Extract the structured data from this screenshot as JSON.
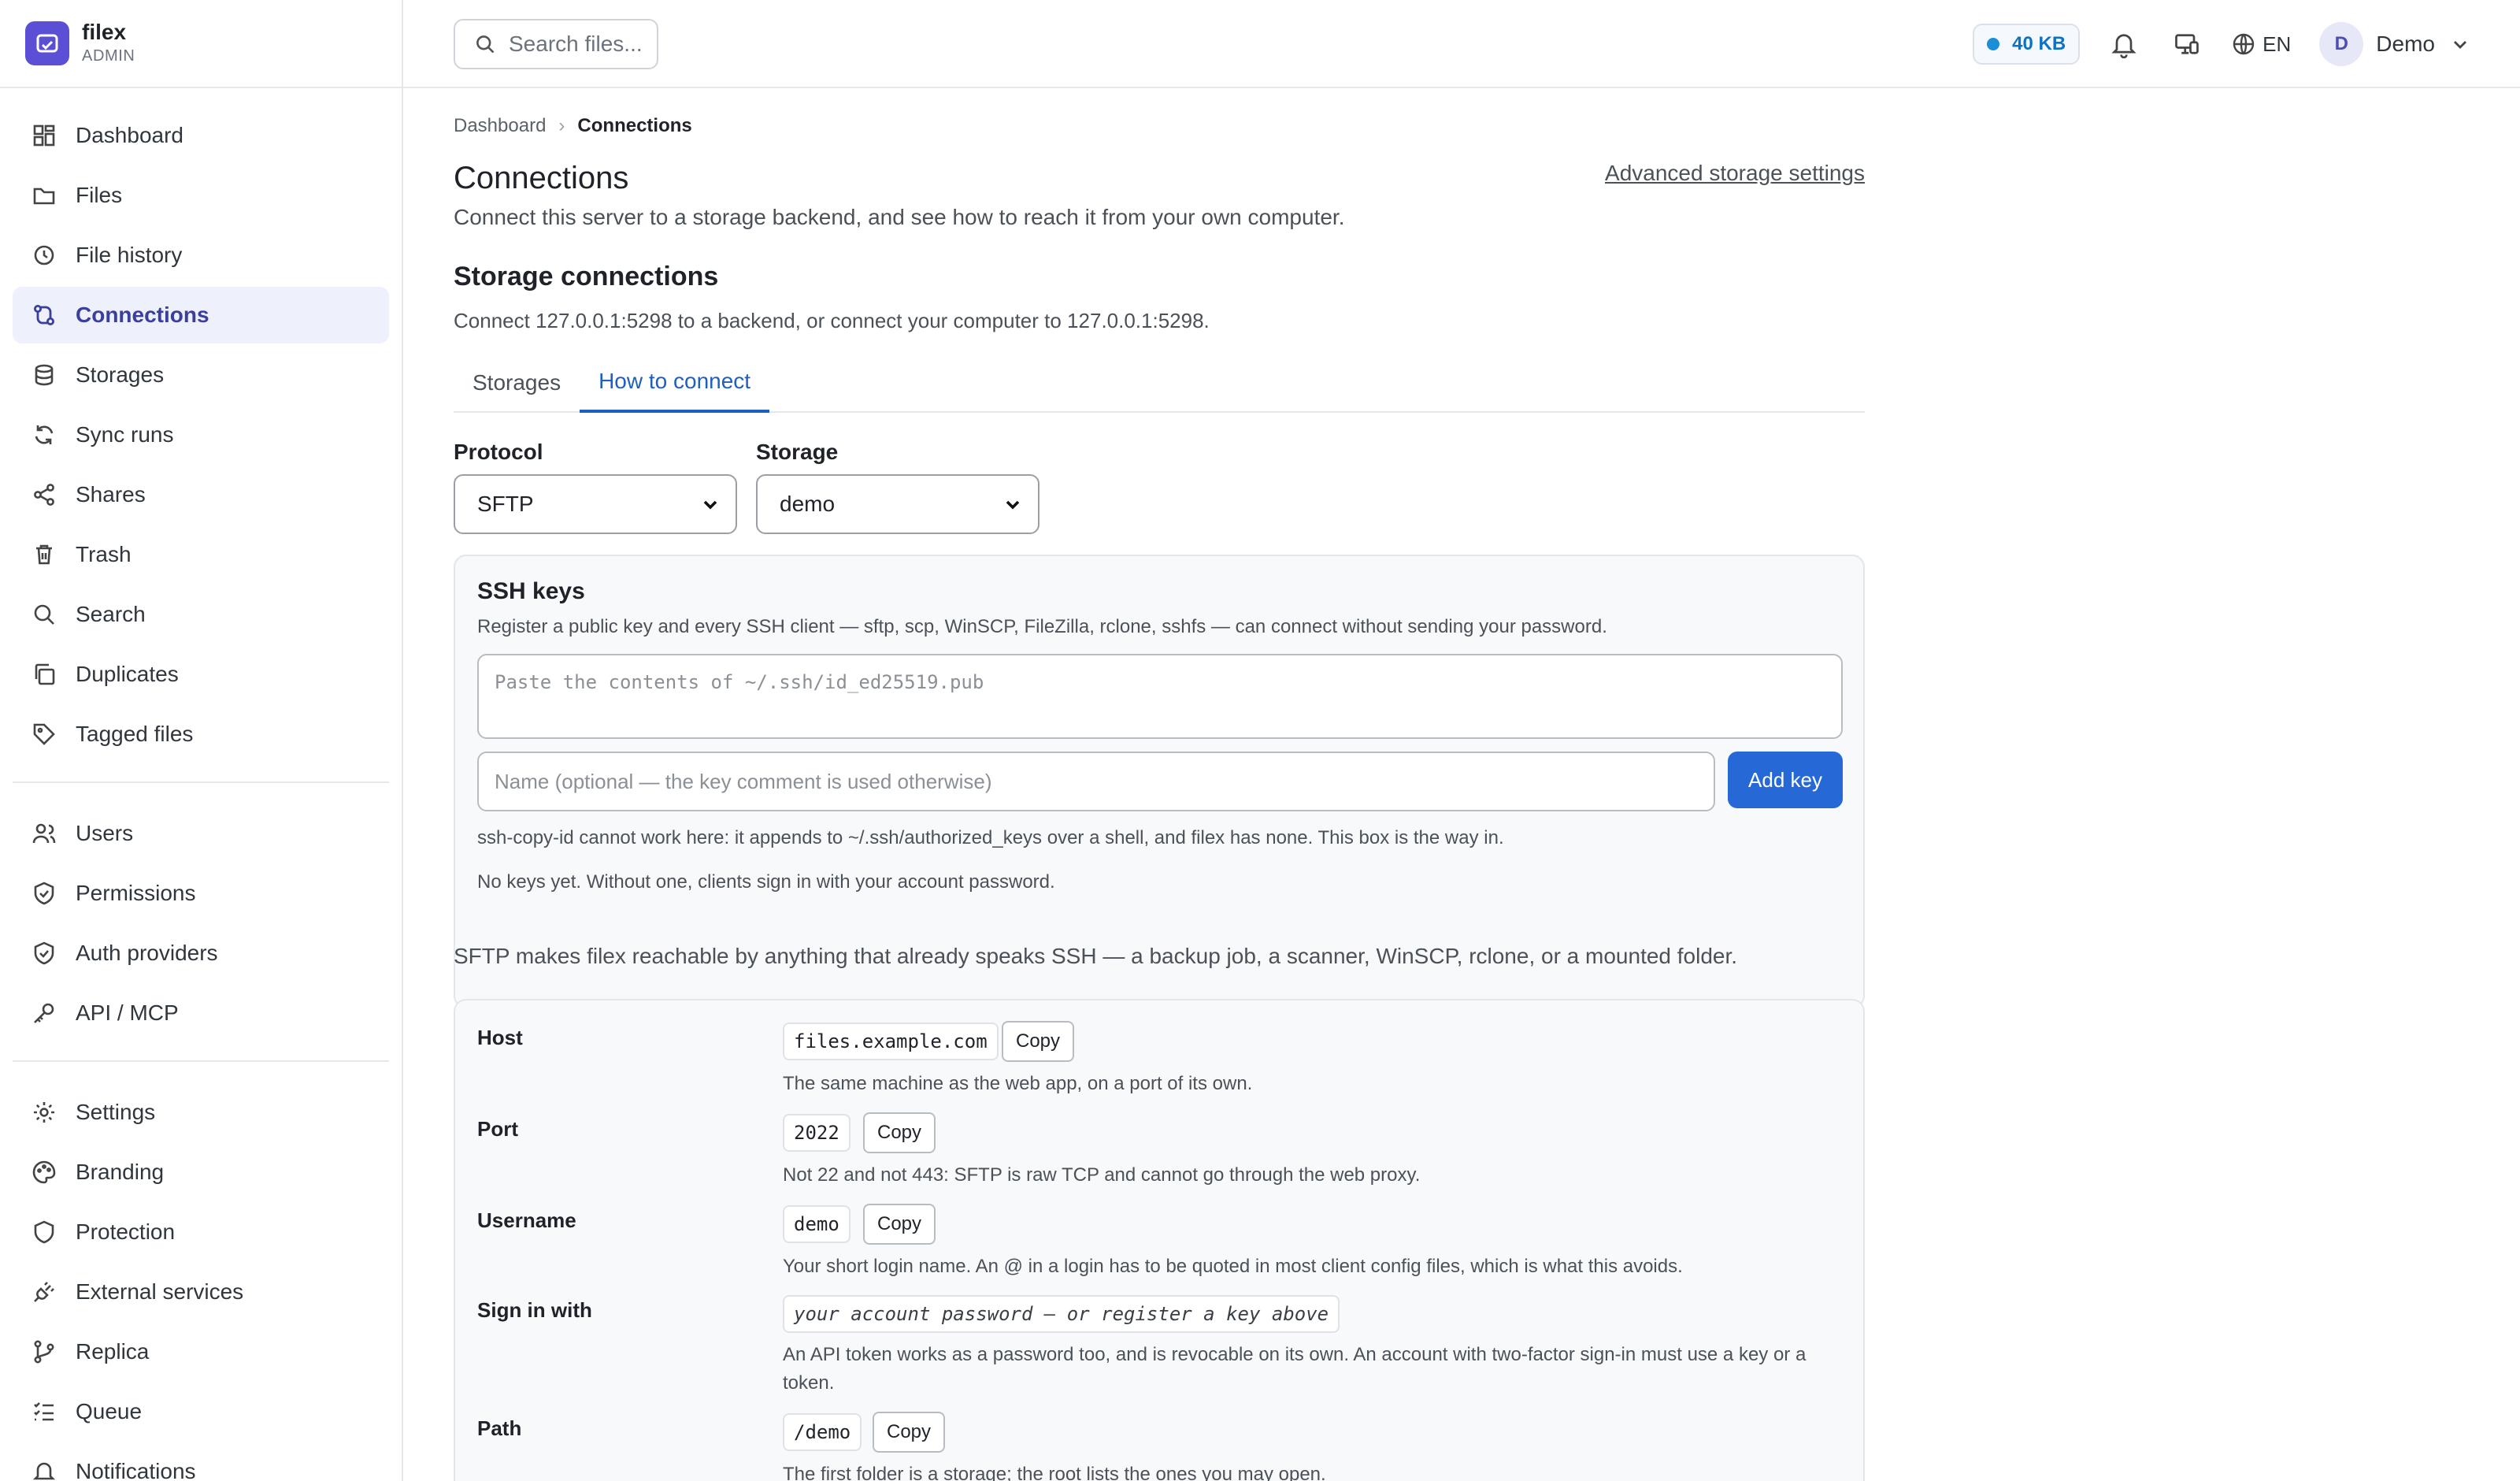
{
  "brand": {
    "name": "filex",
    "role": "ADMIN"
  },
  "sidebar": {
    "group1": [
      {
        "label": "Dashboard",
        "icon": "dashboard-icon",
        "active": false
      },
      {
        "label": "Files",
        "icon": "folder-icon",
        "active": false
      },
      {
        "label": "File history",
        "icon": "history-icon",
        "active": false
      },
      {
        "label": "Connections",
        "icon": "connections-icon",
        "active": true
      },
      {
        "label": "Storages",
        "icon": "database-icon",
        "active": false
      },
      {
        "label": "Sync runs",
        "icon": "sync-icon",
        "active": false
      },
      {
        "label": "Shares",
        "icon": "share-icon",
        "active": false
      },
      {
        "label": "Trash",
        "icon": "trash-icon",
        "active": false
      },
      {
        "label": "Search",
        "icon": "search-icon",
        "active": false
      },
      {
        "label": "Duplicates",
        "icon": "duplicates-icon",
        "active": false
      },
      {
        "label": "Tagged files",
        "icon": "tag-icon",
        "active": false
      }
    ],
    "group2": [
      {
        "label": "Users",
        "icon": "users-icon"
      },
      {
        "label": "Permissions",
        "icon": "shield-check-icon"
      },
      {
        "label": "Auth providers",
        "icon": "shield-check-icon"
      },
      {
        "label": "API / MCP",
        "icon": "key-icon"
      }
    ],
    "group3": [
      {
        "label": "Settings",
        "icon": "gear-icon"
      },
      {
        "label": "Branding",
        "icon": "palette-icon"
      },
      {
        "label": "Protection",
        "icon": "shield-icon"
      },
      {
        "label": "External services",
        "icon": "plug-icon"
      },
      {
        "label": "Replica",
        "icon": "git-branch-icon"
      },
      {
        "label": "Queue",
        "icon": "list-checks-icon"
      },
      {
        "label": "Notifications",
        "icon": "bell-icon"
      }
    ]
  },
  "topbar": {
    "search_placeholder": "Search files...",
    "quota": "40 KB",
    "language": "EN",
    "user_initial": "D",
    "user_name": "Demo"
  },
  "breadcrumb": {
    "root": "Dashboard",
    "current": "Connections"
  },
  "page": {
    "title": "Connections",
    "subtitle": "Connect this server to a storage backend, and see how to reach it from your own computer.",
    "advanced_link": "Advanced storage settings"
  },
  "section": {
    "title": "Storage connections",
    "subtitle": "Connect 127.0.0.1:5298 to a backend, or connect your computer to 127.0.0.1:5298."
  },
  "tabs": [
    {
      "label": "Storages",
      "active": false
    },
    {
      "label": "How to connect",
      "active": true
    }
  ],
  "form": {
    "protocol_label": "Protocol",
    "protocol_value": "SFTP",
    "storage_label": "Storage",
    "storage_value": "demo"
  },
  "ssh": {
    "title": "SSH keys",
    "subtitle": "Register a public key and every SSH client — sftp, scp, WinSCP, FileZilla, rclone, sshfs — can connect without sending your password.",
    "textarea_placeholder": "Paste the contents of ~/.ssh/id_ed25519.pub",
    "name_placeholder": "Name (optional — the key comment is used otherwise)",
    "add_button": "Add key",
    "note1": "ssh-copy-id cannot work here: it appends to ~/.ssh/authorized_keys over a shell, and filex has none. This box is the way in.",
    "note2": "No keys yet. Without one, clients sign in with your account password."
  },
  "intro": "SFTP makes filex reachable by anything that already speaks SSH — a backup job, a scanner, WinSCP, rclone, or a mounted folder.",
  "details": {
    "copy_label": "Copy",
    "host": {
      "label": "Host",
      "value": "files.example.com",
      "help": "The same machine as the web app, on a port of its own."
    },
    "port": {
      "label": "Port",
      "value": "2022",
      "help": "Not 22 and not 443: SFTP is raw TCP and cannot go through the web proxy."
    },
    "username": {
      "label": "Username",
      "value": "demo",
      "help": "Your short login name. An @ in a login has to be quoted in most client config files, which is what this avoids."
    },
    "signin": {
      "label": "Sign in with",
      "value": "your account password — or register a key above",
      "help": "An API token works as a password too, and is revocable on its own. An account with two-factor sign-in must use a key or a token."
    },
    "path": {
      "label": "Path",
      "value": "/demo",
      "help": "The first folder is a storage; the root lists the ones you may open."
    }
  },
  "colors": {
    "accent": "#2568d6",
    "brand": "#5b4fd6",
    "active_nav_bg": "#eef0fb"
  }
}
